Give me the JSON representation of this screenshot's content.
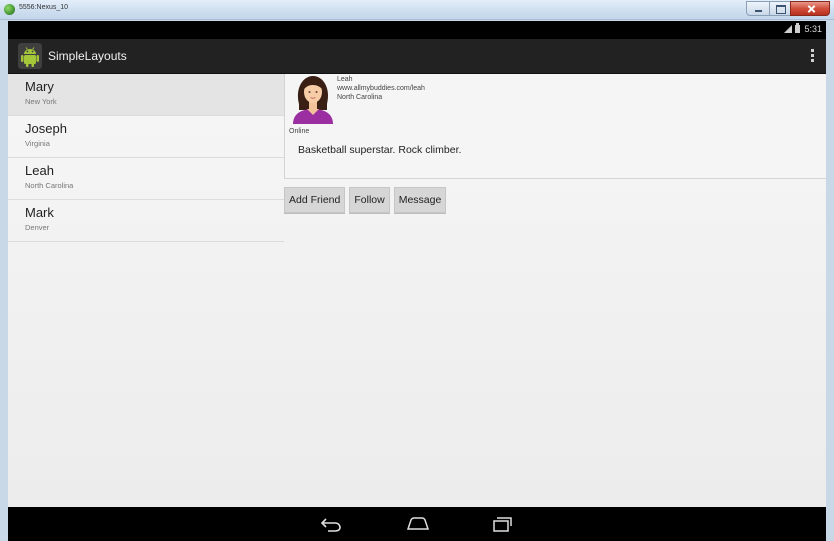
{
  "window": {
    "title": "5556:Nexus_10"
  },
  "status_bar": {
    "time": "5:31"
  },
  "action_bar": {
    "app_title": "SimpleLayouts"
  },
  "contacts": [
    {
      "name": "Mary",
      "location": "New York"
    },
    {
      "name": "Joseph",
      "location": "Virginia"
    },
    {
      "name": "Leah",
      "location": "North Carolina"
    },
    {
      "name": "Mark",
      "location": "Denver"
    }
  ],
  "detail": {
    "name": "Leah",
    "url": "www.allmybuddies.com/leah",
    "location": "North Carolina",
    "status": "Online",
    "bio": "Basketball superstar. Rock climber."
  },
  "actions": {
    "add_friend": "Add Friend",
    "follow": "Follow",
    "message": "Message"
  },
  "icons": {
    "app_logo": "android-robot-icon",
    "overflow": "overflow-menu-icon",
    "back": "back-icon",
    "home": "home-icon",
    "recents": "recent-apps-icon"
  },
  "colors": {
    "action_bar": "#222222",
    "avatar_shirt": "#9b2fa1",
    "android_green": "#a4c639"
  }
}
